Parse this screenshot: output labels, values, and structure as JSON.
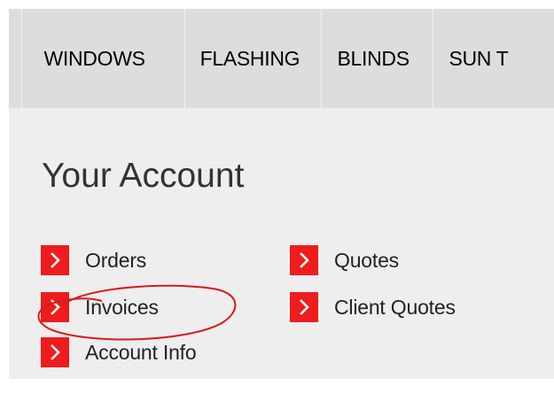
{
  "nav": {
    "items": [
      "WINDOWS",
      "FLASHING",
      "BLINDS",
      "SUN T"
    ]
  },
  "account": {
    "title": "Your Account",
    "links": {
      "orders": "Orders",
      "invoices": "Invoices",
      "account_info": "Account Info",
      "quotes": "Quotes",
      "client_quotes": "Client Quotes"
    }
  },
  "icons": {
    "link_bullet": "chevron-right-icon"
  },
  "colors": {
    "accent": "#ee1c1c",
    "annotation": "#d81a1a",
    "nav_bg": "#dddddd",
    "panel_bg": "#eeeeee"
  }
}
